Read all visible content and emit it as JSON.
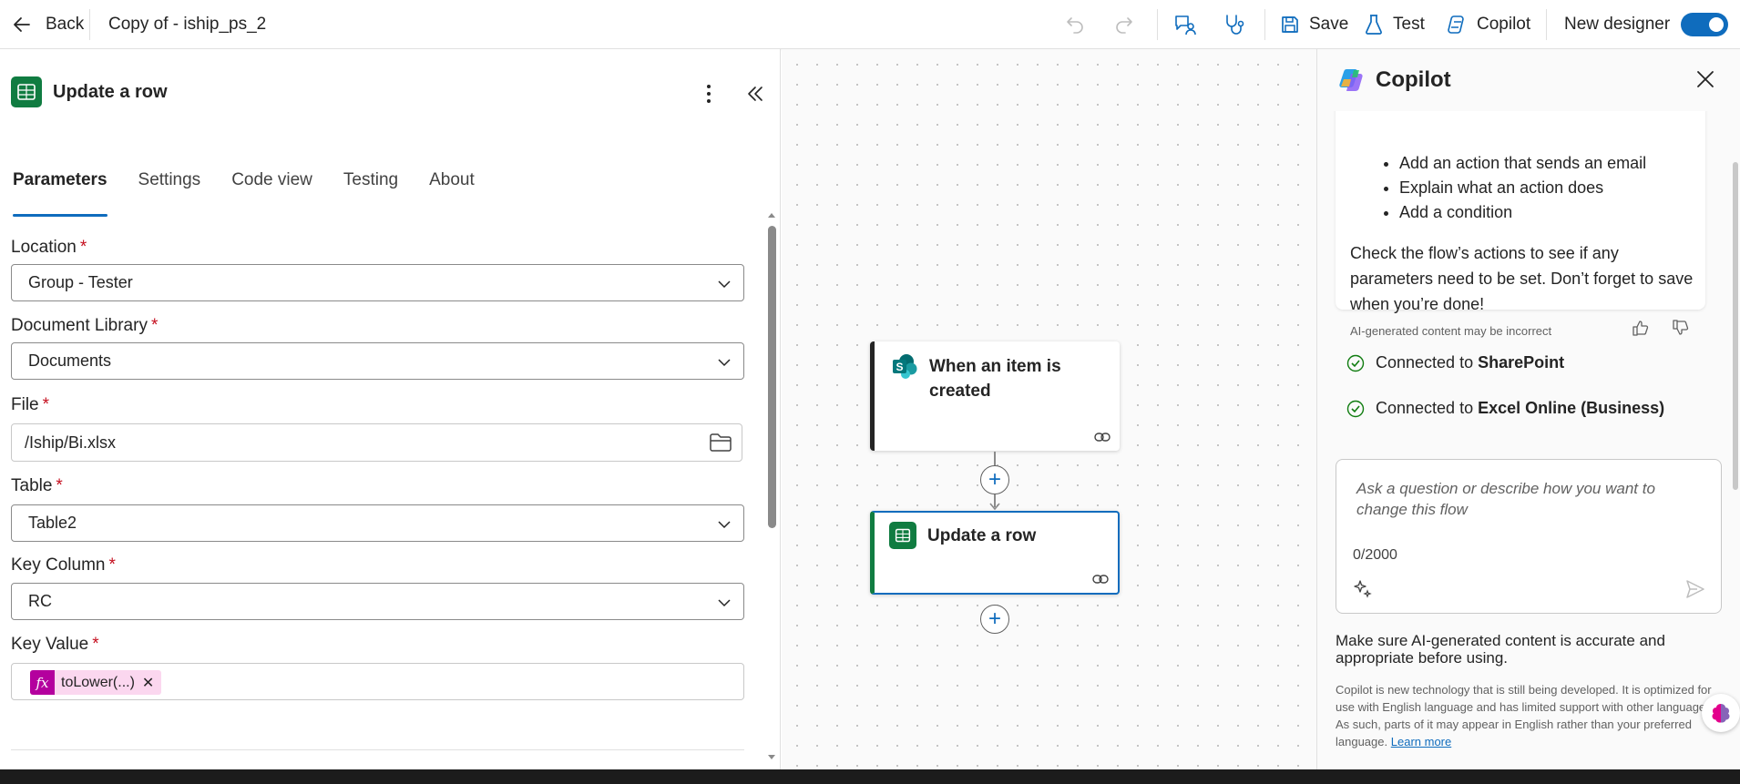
{
  "topbar": {
    "back_label": "Back",
    "flow_title": "Copy of - iship_ps_2",
    "save_label": "Save",
    "test_label": "Test",
    "copilot_label": "Copilot",
    "new_designer_label": "New designer",
    "new_designer_on": true
  },
  "panel": {
    "title": "Update a row",
    "tabs": [
      "Parameters",
      "Settings",
      "Code view",
      "Testing",
      "About"
    ],
    "active_tab": "Parameters",
    "fields": {
      "location": {
        "label": "Location",
        "required": "*",
        "value": "Group - Tester"
      },
      "document_library": {
        "label": "Document Library",
        "required": "*",
        "value": "Documents"
      },
      "file": {
        "label": "File",
        "required": "*",
        "value": "/Iship/Bi.xlsx"
      },
      "table": {
        "label": "Table",
        "required": "*",
        "value": "Table2"
      },
      "key_column": {
        "label": "Key Column",
        "required": "*",
        "value": "RC"
      },
      "key_value": {
        "label": "Key Value",
        "required": "*",
        "token_icon": "fx",
        "token": "toLower(...)"
      }
    }
  },
  "canvas": {
    "trigger_title": "When an item is created",
    "action_title": "Update a row"
  },
  "copilot": {
    "title": "Copilot",
    "suggestions": [
      "Add an action that sends an email",
      "Explain what an action does",
      "Add a condition"
    ],
    "message": "Check the flow’s actions to see if any parameters need to be set. Don’t forget to save when you’re done!",
    "ai_note": "AI-generated content may be incorrect",
    "connected_prefix": "Connected to",
    "connections": [
      "SharePoint",
      "Excel Online (Business)"
    ],
    "input_placeholder": "Ask a question or describe how you want to change this flow",
    "char_count": "0/2000",
    "disclaimer": "Make sure AI-generated content is accurate and appropriate before using.",
    "fine_print": "Copilot is new technology that is still being developed. It is optimized for use with English language and has limited support with other languages. As such, parts of it may appear in English rather than your preferred language.",
    "learn_more": "Learn more"
  },
  "colors": {
    "accent": "#0f6cbd",
    "excel_green": "#107c41",
    "sharepoint_teal": "#03787c",
    "required_red": "#c50f1f",
    "expression_magenta": "#b4009e",
    "success_green": "#107c10"
  }
}
